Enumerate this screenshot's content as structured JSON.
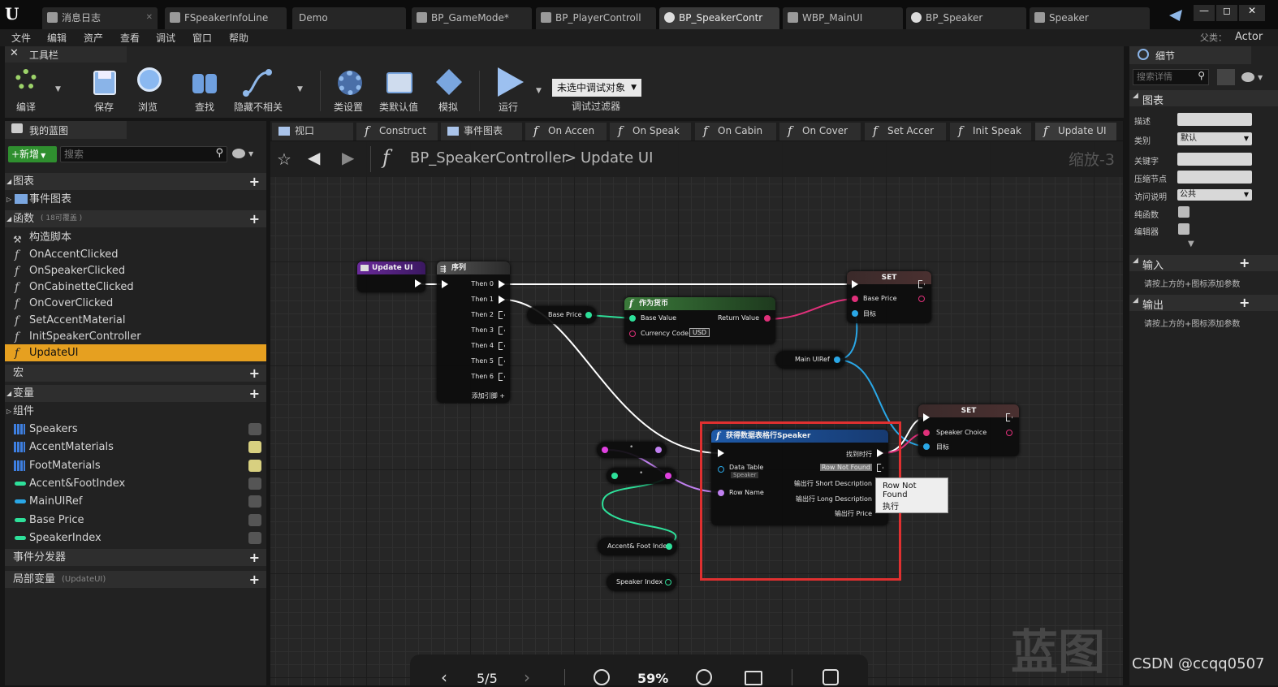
{
  "titlebar": {
    "logo": "U",
    "tabs": [
      {
        "label": "消息日志",
        "active": false
      },
      {
        "label": "FSpeakerInfoLine",
        "active": false
      },
      {
        "label": "Demo",
        "active": false
      },
      {
        "label": "BP_GameMode*",
        "active": false
      },
      {
        "label": "BP_PlayerControll",
        "active": false
      },
      {
        "label": "BP_SpeakerContr",
        "active": true
      },
      {
        "label": "WBP_MainUI",
        "active": false
      },
      {
        "label": "BP_Speaker",
        "active": false
      },
      {
        "label": "Speaker",
        "active": false
      }
    ],
    "window_buttons": [
      "—",
      "◻",
      "✕"
    ]
  },
  "menubar": {
    "items": [
      "文件",
      "编辑",
      "资产",
      "查看",
      "调试",
      "窗口",
      "帮助"
    ],
    "parent_class_label": "父类：",
    "parent_class": "Actor"
  },
  "toolbar": {
    "title": "工具栏",
    "buttons": [
      "编译",
      "保存",
      "浏览",
      "查找",
      "隐藏不相关",
      "类设置",
      "类默认值",
      "模拟",
      "运行"
    ],
    "debug_select": "未选中调试对象",
    "debug_filter": "调试过滤器"
  },
  "left": {
    "title": "我的蓝图",
    "new_button": "+新增",
    "search_placeholder": "搜索",
    "sections": {
      "graphs": "图表",
      "event_graph": "事件图表",
      "functions": "函数",
      "functions_note": "( 18可覆盖 )",
      "macros": "宏",
      "variables": "变量",
      "components": "组件",
      "dispatchers": "事件分发器",
      "locals": "局部变量",
      "locals_note": "(UpdateUI)"
    },
    "functions": [
      "构造脚本",
      "OnAccentClicked",
      "OnSpeakerClicked",
      "OnCabinetteClicked",
      "OnCoverClicked",
      "SetAccentMaterial",
      "InitSpeakerController",
      "UpdateUI"
    ],
    "variables": [
      "Speakers",
      "AccentMaterials",
      "FootMaterials",
      "Accent&FootIndex",
      "MainUIRef",
      "Base Price",
      "SpeakerIndex"
    ]
  },
  "center": {
    "tabs": [
      "视口",
      "Construct",
      "事件图表",
      "On Accen",
      "On Speak",
      "On Cabin",
      "On Cover",
      "Set Accer",
      "Init Speak",
      "Update UI"
    ],
    "breadcrumb_bp": "BP_SpeakerController",
    "breadcrumb_sep": ">",
    "breadcrumb_fn": "Update UI",
    "zoom_label": "缩放-3",
    "watermark": "蓝图"
  },
  "nodes": {
    "update_ui": "Update UI",
    "sequence": {
      "title": "序列",
      "pins": [
        "Then 0",
        "Then 1",
        "Then 2",
        "Then 3",
        "Then 4",
        "Then 5",
        "Then 6"
      ],
      "add_pin": "添加引脚 +"
    },
    "as_currency": {
      "title": "作为货币",
      "in1": "Base Value",
      "in2": "Currency Code",
      "currency": "USD",
      "out": "Return Value"
    },
    "base_price_var": "Base Price",
    "set1": {
      "title": "SET",
      "pin1": "Base Price",
      "pin2": "目标"
    },
    "main_ui_ref": "Main UIRef",
    "set2": {
      "title": "SET",
      "pin1": "Speaker Choice",
      "pin2": "目标"
    },
    "get_row": {
      "title": "获得数据表格行Speaker",
      "found": "找到时行",
      "not_found": "Row Not Found",
      "data_table": "Data Table",
      "data_table_value": "Speaker",
      "row_name": "Row Name",
      "out1": "输出行 Short Description",
      "out2": "输出行 Long Description",
      "out3": "输出行 Price"
    },
    "tooltip": "Row Not Found\n执行",
    "accent_var": "Accent& Foot Index",
    "speaker_var": "Speaker Index"
  },
  "zoombar": {
    "page": "5/5",
    "zoom": "59%"
  },
  "right": {
    "title": "细节",
    "search_placeholder": "搜索详情",
    "graph_section": "图表",
    "rows": [
      {
        "label": "描述",
        "value": ""
      },
      {
        "label": "类别",
        "value": "默认"
      },
      {
        "label": "关键字",
        "value": ""
      },
      {
        "label": "压缩节点",
        "value": ""
      },
      {
        "label": "访问说明",
        "value": "公共"
      },
      {
        "label": "纯函数",
        "value": ""
      },
      {
        "label": "编辑器",
        "value": ""
      }
    ],
    "inputs": "输入",
    "outputs": "输出",
    "hint": "请按上方的+图标添加参数"
  },
  "watermark_csdn": "CSDN @ccqq0507",
  "colors": {
    "accent_orange": "#e6a020",
    "highlight_red": "#e03030",
    "exec_white": "#ffffff",
    "float_green": "#2ee09a",
    "string_pink": "#e0307a",
    "object_blue": "#2aa7e6",
    "struct_blue": "#2060c0"
  }
}
